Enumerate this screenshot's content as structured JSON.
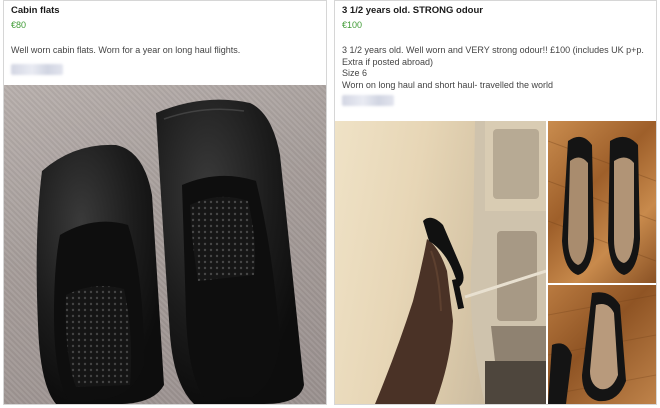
{
  "listings": [
    {
      "title": "Cabin flats",
      "price": "€80",
      "description": "Well worn cabin flats. Worn for a year on long haul flights.",
      "photos": [
        "black-flats-on-carpet"
      ]
    },
    {
      "title": "3 1/2 years old. STRONG odour",
      "price": "€100",
      "description": [
        "3 1/2 years old. Well worn and VERY strong odour!! £100 (includes UK p+p.",
        "Extra if posted abroad)",
        "Size 6",
        "Worn on long haul and short haul- travelled the world"
      ],
      "photos": [
        "heel-on-leg-in-aircraft-cabin",
        "pair-of-heels-on-wood-floor",
        "worn-insole-closeup"
      ]
    }
  ],
  "colors": {
    "price": "#3f9b35",
    "title": "#1a1a1a",
    "border": "#d6d6d6"
  }
}
